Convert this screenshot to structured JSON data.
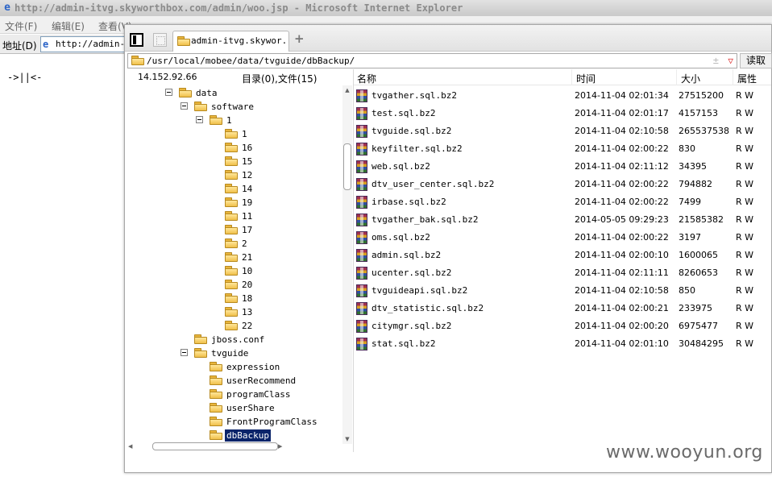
{
  "ie": {
    "title": "http://admin-itvg.skyworthbox.com/admin/woo.jsp - Microsoft Internet Explorer",
    "menu": [
      "文件(F)",
      "编辑(E)",
      "查看(V)"
    ],
    "address_label": "地址(D)",
    "address_value": "http://admin-i",
    "page_text": "->||<-"
  },
  "fm": {
    "tab_label": "admin-itvg.skywor...",
    "new_tab": "+",
    "path": "/usr/local/mobee/data/tvguide/dbBackup/",
    "path_pm": "±",
    "path_dropdown": "▽",
    "read_button": "读取",
    "ip": "14.152.92.66",
    "counts": "目录(0),文件(15)",
    "tree": [
      {
        "label": "data",
        "level": 0,
        "toggle": true
      },
      {
        "label": "software",
        "level": 1,
        "toggle": true
      },
      {
        "label": "1",
        "level": 2,
        "toggle": true
      },
      {
        "label": "1",
        "level": 3,
        "toggle": false
      },
      {
        "label": "16",
        "level": 3,
        "toggle": false
      },
      {
        "label": "15",
        "level": 3,
        "toggle": false
      },
      {
        "label": "12",
        "level": 3,
        "toggle": false
      },
      {
        "label": "14",
        "level": 3,
        "toggle": false
      },
      {
        "label": "19",
        "level": 3,
        "toggle": false
      },
      {
        "label": "11",
        "level": 3,
        "toggle": false
      },
      {
        "label": "17",
        "level": 3,
        "toggle": false
      },
      {
        "label": "2",
        "level": 3,
        "toggle": false
      },
      {
        "label": "21",
        "level": 3,
        "toggle": false
      },
      {
        "label": "10",
        "level": 3,
        "toggle": false
      },
      {
        "label": "20",
        "level": 3,
        "toggle": false
      },
      {
        "label": "18",
        "level": 3,
        "toggle": false
      },
      {
        "label": "13",
        "level": 3,
        "toggle": false
      },
      {
        "label": "22",
        "level": 3,
        "toggle": false
      },
      {
        "label": "jboss.conf",
        "level": 1,
        "toggle": false
      },
      {
        "label": "tvguide",
        "level": 1,
        "toggle": true
      },
      {
        "label": "expression",
        "level": 2,
        "toggle": false
      },
      {
        "label": "userRecommend",
        "level": 2,
        "toggle": false
      },
      {
        "label": "programClass",
        "level": 2,
        "toggle": false
      },
      {
        "label": "userShare",
        "level": 2,
        "toggle": false
      },
      {
        "label": "FrontProgramClass",
        "level": 2,
        "toggle": false
      },
      {
        "label": "dbBackup",
        "level": 2,
        "toggle": false,
        "selected": true
      }
    ],
    "columns": {
      "name": "名称",
      "time": "时间",
      "size": "大小",
      "attr": "属性"
    },
    "files": [
      {
        "name": "tvgather.sql.bz2",
        "time": "2014-11-04 02:01:34",
        "size": "27515200",
        "perm": "R W"
      },
      {
        "name": "test.sql.bz2",
        "time": "2014-11-04 02:01:17",
        "size": "4157153",
        "perm": "R W"
      },
      {
        "name": "tvguide.sql.bz2",
        "time": "2014-11-04 02:10:58",
        "size": "265537538",
        "perm": "R W"
      },
      {
        "name": "keyfilter.sql.bz2",
        "time": "2014-11-04 02:00:22",
        "size": "830",
        "perm": "R W"
      },
      {
        "name": "web.sql.bz2",
        "time": "2014-11-04 02:11:12",
        "size": "34395",
        "perm": "R W"
      },
      {
        "name": "dtv_user_center.sql.bz2",
        "time": "2014-11-04 02:00:22",
        "size": "794882",
        "perm": "R W"
      },
      {
        "name": "irbase.sql.bz2",
        "time": "2014-11-04 02:00:22",
        "size": "7499",
        "perm": "R W"
      },
      {
        "name": "tvgather_bak.sql.bz2",
        "time": "2014-05-05 09:29:23",
        "size": "21585382",
        "perm": "R W"
      },
      {
        "name": "oms.sql.bz2",
        "time": "2014-11-04 02:00:22",
        "size": "3197",
        "perm": "R W"
      },
      {
        "name": "admin.sql.bz2",
        "time": "2014-11-04 02:00:10",
        "size": "1600065",
        "perm": "R W"
      },
      {
        "name": "ucenter.sql.bz2",
        "time": "2014-11-04 02:11:11",
        "size": "8260653",
        "perm": "R W"
      },
      {
        "name": "tvguideapi.sql.bz2",
        "time": "2014-11-04 02:10:58",
        "size": "850",
        "perm": "R W"
      },
      {
        "name": "dtv_statistic.sql.bz2",
        "time": "2014-11-04 02:00:21",
        "size": "233975",
        "perm": "R W"
      },
      {
        "name": "citymgr.sql.bz2",
        "time": "2014-11-04 02:00:20",
        "size": "6975477",
        "perm": "R W"
      },
      {
        "name": "stat.sql.bz2",
        "time": "2014-11-04 02:01:10",
        "size": "30484295",
        "perm": "R W"
      }
    ]
  },
  "watermark": "www.wooyun.org"
}
